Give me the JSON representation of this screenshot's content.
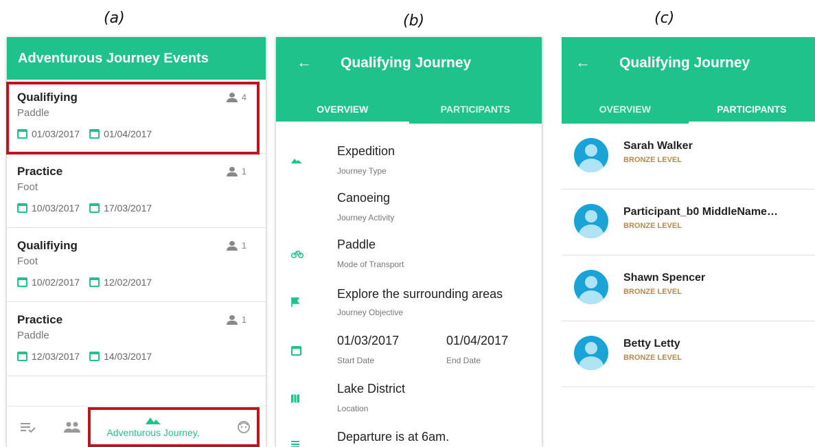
{
  "captions": {
    "a": "(a)",
    "b": "(b)",
    "c": "(c)"
  },
  "colors": {
    "accent": "#1fc28b",
    "highlight": "#c0141c",
    "level": "#b8894a"
  },
  "panel_a": {
    "title": "Adventurous Journey Events",
    "events": [
      {
        "type": "Qualifiying",
        "transport": "Paddle",
        "count": "4",
        "start": "01/03/2017",
        "end": "01/04/2017"
      },
      {
        "type": "Practice",
        "transport": "Foot",
        "count": "1",
        "start": "10/03/2017",
        "end": "17/03/2017"
      },
      {
        "type": "Qualifiying",
        "transport": "Foot",
        "count": "1",
        "start": "10/02/2017",
        "end": "12/02/2017"
      },
      {
        "type": "Practice",
        "transport": "Paddle",
        "count": "1",
        "start": "12/03/2017",
        "end": "14/03/2017"
      }
    ],
    "bottom_nav": {
      "active_label": "Adventurous Journey,"
    }
  },
  "panel_b": {
    "title": "Qualifying Journey",
    "tabs": [
      "OVERVIEW",
      "PARTICIPANTS"
    ],
    "rows": [
      {
        "main": "Expedition",
        "sub": "Journey Type",
        "icon": "mountain-icon"
      },
      {
        "main": "Canoeing",
        "sub": "Journey Activity",
        "icon": ""
      },
      {
        "main": "Paddle",
        "sub": "Mode of Transport",
        "icon": "bike-icon"
      },
      {
        "main": "Explore the surrounding areas",
        "sub": "Journey Objective",
        "icon": "flag-icon"
      },
      {
        "main": "01/03/2017",
        "sub": "Start Date",
        "main2": "01/04/2017",
        "sub2": "End Date",
        "icon": "calendar-icon"
      },
      {
        "main": "Lake District",
        "sub": "Location",
        "icon": "map-icon"
      },
      {
        "main": "Departure is at 6am.",
        "sub": "",
        "icon": "notes-icon"
      }
    ]
  },
  "panel_c": {
    "title": "Qualifying Journey",
    "tabs": [
      "OVERVIEW",
      "PARTICIPANTS"
    ],
    "participants": [
      {
        "name": "Sarah Walker",
        "level": "BRONZE LEVEL"
      },
      {
        "name": "Participant_b0 MiddleName…",
        "level": "BRONZE LEVEL"
      },
      {
        "name": "Shawn Spencer",
        "level": "BRONZE LEVEL"
      },
      {
        "name": "Betty Letty",
        "level": "BRONZE LEVEL"
      }
    ]
  }
}
